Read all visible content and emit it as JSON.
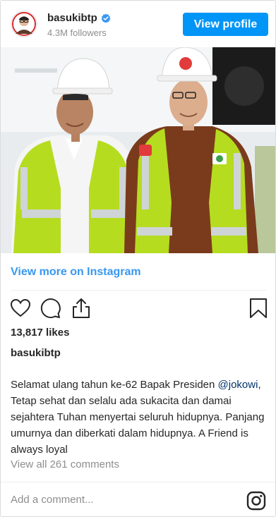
{
  "header": {
    "username": "basukibtp",
    "followers": "4.3M followers",
    "view_profile_label": "View profile",
    "verified_icon": "verified-badge-icon",
    "accent_color": "#0095f6"
  },
  "photo": {
    "description_icon": "post-photo"
  },
  "view_more_label": "View more on Instagram",
  "actions": {
    "icons": [
      "heart-icon",
      "comment-icon",
      "share-icon",
      "bookmark-icon"
    ]
  },
  "likes": "13,817 likes",
  "author": "basukibtp",
  "caption": {
    "prefix": "Selamat ulang tahun ke-62 Bapak Presiden ",
    "mention": "@jokowi",
    "suffix": ", Tetap sehat dan selalu ada sukacita dan damai sejahtera Tuhan menyertai seluruh hidupnya. Panjang umurnya dan diberkati dalam hidupnya. A Friend is always loyal"
  },
  "view_all_comments": "View all 261 comments",
  "add_comment_placeholder": "Add a comment...",
  "link_color": "#3897f0"
}
